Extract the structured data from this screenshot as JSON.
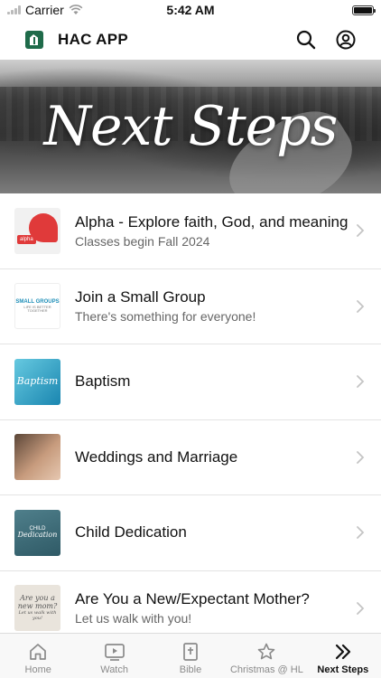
{
  "status_bar": {
    "carrier": "Carrier",
    "time": "5:42 AM"
  },
  "header": {
    "title": "HAC APP",
    "icons": [
      "app-logo-icon",
      "search-icon",
      "account-icon"
    ]
  },
  "hero": {
    "title": "Next Steps"
  },
  "items": [
    {
      "title": "Alpha - Explore faith, God, and meaning",
      "subtitle": "Classes begin Fall 2024",
      "thumb": "alpha",
      "thumb_badge": "alpha"
    },
    {
      "title": "Join a Small Group",
      "subtitle": "There's something for everyone!",
      "thumb": "small-groups",
      "thumb_text": "SMALL GROUPS",
      "thumb_subtext": "LIFE IS BETTER TOGETHER"
    },
    {
      "title": "Baptism",
      "subtitle": "",
      "thumb": "baptism",
      "thumb_text": "Baptism"
    },
    {
      "title": "Weddings and Marriage",
      "subtitle": "",
      "thumb": "weddings"
    },
    {
      "title": "Child Dedication",
      "subtitle": "",
      "thumb": "child-dedication",
      "thumb_text": "CHILD",
      "thumb_subtext": "Dedication"
    },
    {
      "title": "Are You a New/Expectant Mother?",
      "subtitle": "Let us walk with you!",
      "thumb": "mother",
      "thumb_text": "Are you a new mom?",
      "thumb_subtext": "Let us walk with you!"
    }
  ],
  "tabs": [
    {
      "label": "Home",
      "icon": "home-icon",
      "active": false
    },
    {
      "label": "Watch",
      "icon": "play-icon",
      "active": false
    },
    {
      "label": "Bible",
      "icon": "bible-icon",
      "active": false
    },
    {
      "label": "Christmas @ HL",
      "icon": "star-icon",
      "active": false
    },
    {
      "label": "Next Steps",
      "icon": "double-chevron-icon",
      "active": true
    }
  ],
  "colors": {
    "accent": "#1f6b4a",
    "active_tab": "#111111",
    "inactive_tab": "#8a8a8a"
  }
}
